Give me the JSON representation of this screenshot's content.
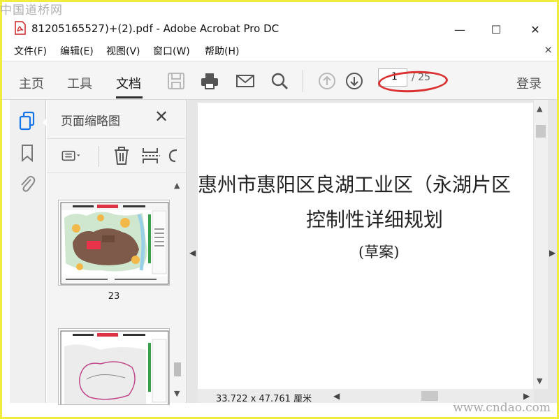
{
  "watermarks": {
    "top": "中国道桥网",
    "bottom": "www.cndao.com"
  },
  "window": {
    "title": "81205165527)+(2).pdf - Adobe Acrobat Pro DC",
    "minimize": "—",
    "maximize": "☐",
    "close": "✕"
  },
  "menu": {
    "items": [
      "文件(F)",
      "编辑(E)",
      "视图(V)",
      "窗口(W)",
      "帮助(H)"
    ],
    "close": "×"
  },
  "toolbar": {
    "tabs": [
      "主页",
      "工具",
      "文档"
    ],
    "active_tab": "文档",
    "page_current": "1",
    "page_total": "/ 25",
    "login": "登录"
  },
  "thumbnail_panel": {
    "title": "页面缩略图",
    "close": "✕",
    "thumbnails": [
      {
        "label": "23"
      },
      {
        "label": ""
      }
    ]
  },
  "document": {
    "line1": "惠州市惠阳区良湖工业区（永湖片区",
    "line2": "控制性详细规划",
    "line3": "(草案)"
  },
  "status": {
    "dimensions": "33.722 x 47.761 厘米"
  },
  "colors": {
    "annotation": "#d93030",
    "toolbar_bg": "#f5f5f5",
    "watermark": "#b0b0b0"
  }
}
